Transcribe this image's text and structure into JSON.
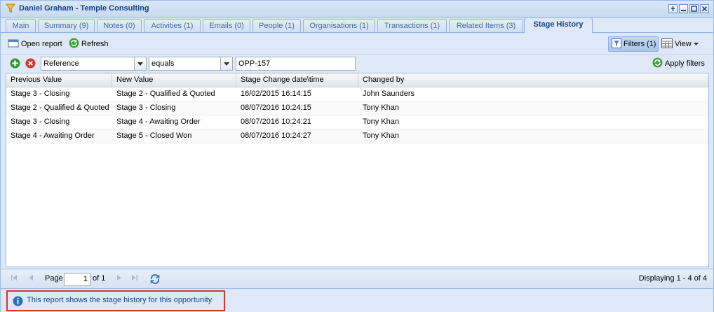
{
  "window": {
    "title": "Daniel Graham - Temple Consulting",
    "controls": [
      "pin-icon",
      "minimize-icon",
      "maximize-icon",
      "close-icon"
    ]
  },
  "tabs": [
    {
      "label": "Main"
    },
    {
      "label": "Summary (9)"
    },
    {
      "label": "Notes (0)"
    },
    {
      "label": "Activities (1)"
    },
    {
      "label": "Emails (0)"
    },
    {
      "label": "People (1)"
    },
    {
      "label": "Organisations (1)"
    },
    {
      "label": "Transactions (1)"
    },
    {
      "label": "Related Items (3)"
    },
    {
      "label": "Stage History",
      "active": true
    }
  ],
  "toolbar": {
    "open_report": "Open report",
    "refresh": "Refresh",
    "filters": "Filters (1)",
    "view": "View"
  },
  "filter": {
    "field": "Reference",
    "operator": "equals",
    "value": "OPP-157",
    "apply": "Apply filters"
  },
  "grid": {
    "columns": [
      "Previous Value",
      "New Value",
      "Stage Change date\\time",
      "Changed by"
    ],
    "rows": [
      [
        "Stage 3 - Closing",
        "Stage 2 - Qualified & Quoted",
        "16/02/2015 16:14:15",
        "John Saunders"
      ],
      [
        "Stage 2 - Qualified & Quoted",
        "Stage 3 - Closing",
        "08/07/2016 10:24:15",
        "Tony Khan"
      ],
      [
        "Stage 3 - Closing",
        "Stage 4 - Awaiting Order",
        "08/07/2016 10:24:21",
        "Tony Khan"
      ],
      [
        "Stage 4 - Awaiting Order",
        "Stage 5 - Closed Won",
        "08/07/2016 10:24:27",
        "Tony Khan"
      ]
    ]
  },
  "pager": {
    "page_label": "Page",
    "current_page": "1",
    "of_label": "of 1",
    "displaying": "Displaying 1 - 4 of 4"
  },
  "status": {
    "message": "This report shows the stage history for this opportunity"
  },
  "colors": {
    "accent": "#15428b",
    "frame": "#99bbe8",
    "highlight_box": "#e0302f"
  }
}
